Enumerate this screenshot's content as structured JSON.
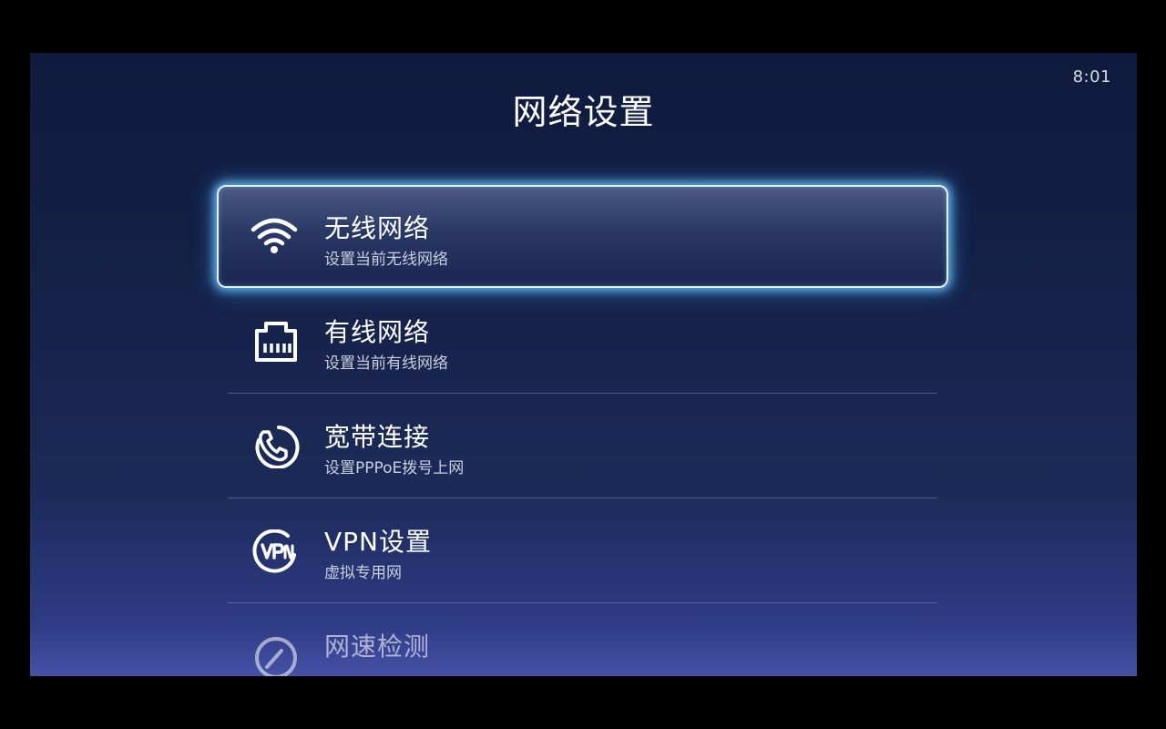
{
  "status_bar": {
    "time": "8:01"
  },
  "header": {
    "title": "网络设置"
  },
  "menu": {
    "items": [
      {
        "icon": "wifi-icon",
        "title": "无线网络",
        "subtitle": "设置当前无线网络"
      },
      {
        "icon": "ethernet-icon",
        "title": "有线网络",
        "subtitle": "设置当前有线网络"
      },
      {
        "icon": "phone-icon",
        "title": "宽带连接",
        "subtitle": "设置PPPoE拨号上网"
      },
      {
        "icon": "vpn-icon",
        "title": "VPN设置",
        "subtitle": "虚拟专用网"
      },
      {
        "icon": "speedometer-icon",
        "title": "网速检测",
        "subtitle": ""
      }
    ]
  },
  "colors": {
    "focus_glow": "#6ec8ff",
    "background_top": "#0f1b3d",
    "background_bottom": "#4651a6"
  }
}
